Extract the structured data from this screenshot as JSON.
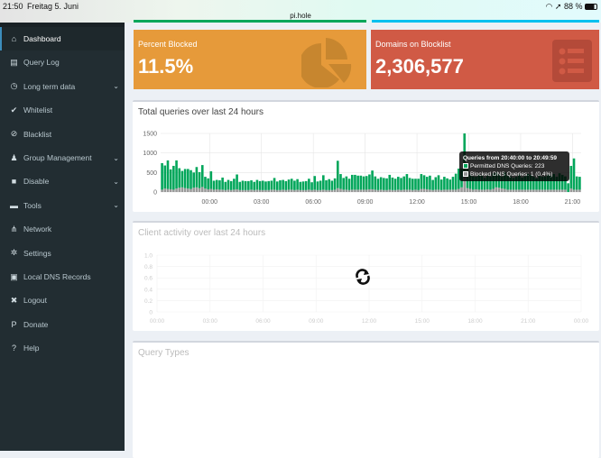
{
  "statusbar": {
    "time": "21:50",
    "date": "Freitag 5. Juni",
    "url": "pi.hole",
    "battery": "88 %"
  },
  "sidebar": {
    "items": [
      {
        "label": "Dashboard",
        "icon": "home-icon",
        "active": true
      },
      {
        "label": "Query Log",
        "icon": "file-icon"
      },
      {
        "label": "Long term data",
        "icon": "clock-icon",
        "chevron": true
      },
      {
        "label": "Whitelist",
        "icon": "check-circle-icon"
      },
      {
        "label": "Blacklist",
        "icon": "ban-icon"
      },
      {
        "label": "Group Management",
        "icon": "users-icon",
        "chevron": true
      },
      {
        "label": "Disable",
        "icon": "stop-icon",
        "chevron": true
      },
      {
        "label": "Tools",
        "icon": "folder-icon",
        "chevron": true
      },
      {
        "label": "Network",
        "icon": "network-icon"
      },
      {
        "label": "Settings",
        "icon": "gears-icon"
      },
      {
        "label": "Local DNS Records",
        "icon": "address-book-icon"
      },
      {
        "label": "Logout",
        "icon": "user-times-icon"
      },
      {
        "label": "Donate",
        "icon": "paypal-icon"
      },
      {
        "label": "Help",
        "icon": "question-circle-icon"
      }
    ]
  },
  "stats": {
    "percent_blocked": {
      "label": "Percent Blocked",
      "value": "11.5%",
      "color": "#e69a3a",
      "icon": "pie-chart-icon"
    },
    "domains": {
      "label": "Domains on Blocklist",
      "value": "2,306,577",
      "color": "#d05a45",
      "icon": "list-icon"
    }
  },
  "chart_data": [
    {
      "type": "bar",
      "title": "Total queries over last 24 hours",
      "stacked": true,
      "x_tick_labels": [
        "00:00",
        "03:00",
        "06:00",
        "09:00",
        "12:00",
        "15:00",
        "18:00",
        "21:00"
      ],
      "ylim": [
        0,
        1500
      ],
      "y_ticks": [
        0,
        500,
        1000,
        1500
      ],
      "grid": true,
      "series": [
        {
          "name": "Permitted DNS Queries",
          "color": "#00a65a",
          "values": [
            680,
            590,
            730,
            510,
            610,
            720,
            500,
            420,
            490,
            500,
            480,
            390,
            520,
            410,
            560,
            300,
            280,
            450,
            230,
            240,
            240,
            310,
            210,
            250,
            230,
            280,
            380,
            210,
            240,
            230,
            230,
            240,
            210,
            250,
            230,
            240,
            220,
            230,
            230,
            300,
            220,
            250,
            250,
            230,
            260,
            280,
            240,
            270,
            210,
            220,
            230,
            280,
            200,
            350,
            220,
            240,
            370,
            250,
            280,
            240,
            290,
            700,
            380,
            300,
            340,
            290,
            380,
            380,
            360,
            360,
            340,
            350,
            380,
            480,
            340,
            290,
            320,
            310,
            300,
            380,
            320,
            290,
            330,
            310,
            340,
            400,
            300,
            290,
            280,
            290,
            380,
            350,
            320,
            360,
            260,
            320,
            370,
            270,
            330,
            290,
            260,
            330,
            410,
            520,
            480,
            1080,
            560,
            360,
            340,
            320,
            380,
            360,
            300,
            350,
            330,
            400,
            380,
            340,
            300,
            420,
            360,
            340,
            300,
            330,
            380,
            310,
            340,
            400,
            380,
            330,
            290,
            350,
            330,
            340,
            380,
            360,
            400,
            330,
            420,
            380,
            340,
            223,
            580,
            800,
            340,
            330
          ]
        },
        {
          "name": "Blocked DNS Queries",
          "color": "#999999",
          "values": [
            60,
            90,
            80,
            70,
            60,
            90,
            110,
            120,
            100,
            90,
            80,
            110,
            120,
            100,
            130,
            90,
            70,
            80,
            60,
            70,
            60,
            60,
            50,
            60,
            50,
            60,
            70,
            50,
            50,
            50,
            50,
            60,
            50,
            60,
            50,
            50,
            50,
            50,
            60,
            60,
            50,
            50,
            60,
            50,
            60,
            60,
            50,
            60,
            50,
            50,
            50,
            60,
            50,
            60,
            50,
            50,
            60,
            50,
            50,
            50,
            60,
            100,
            80,
            60,
            60,
            50,
            60,
            60,
            60,
            60,
            60,
            60,
            70,
            70,
            60,
            50,
            60,
            50,
            50,
            60,
            50,
            50,
            60,
            50,
            60,
            60,
            60,
            50,
            60,
            50,
            80,
            80,
            70,
            60,
            50,
            60,
            60,
            50,
            60,
            60,
            60,
            60,
            60,
            80,
            120,
            420,
            100,
            80,
            60,
            70,
            60,
            60,
            60,
            70,
            60,
            80,
            120,
            110,
            90,
            80,
            60,
            60,
            60,
            60,
            60,
            60,
            60,
            60,
            60,
            60,
            60,
            60,
            60,
            60,
            60,
            60,
            60,
            60,
            60,
            60,
            60,
            1,
            90,
            60,
            60,
            60
          ]
        }
      ],
      "tooltip": {
        "title": "Queries from 20:40:00 to 20:49:59",
        "lines": [
          "Permitted DNS Queries: 223",
          "Blocked DNS Queries: 1 (0.4%)"
        ]
      }
    },
    {
      "type": "line",
      "title": "Client activity over last 24 hours",
      "loading": true,
      "x_tick_labels": [
        "00:00",
        "03:00",
        "06:00",
        "09:00",
        "12:00",
        "15:00",
        "18:00",
        "21:00",
        "00:00"
      ],
      "y_tick_labels": [
        "1.0",
        "0.8",
        "0.6",
        "0.4",
        "0.2",
        "0"
      ],
      "ylim": [
        0,
        1
      ],
      "grid": true,
      "series": []
    }
  ],
  "query_types": {
    "title": "Query Types"
  }
}
